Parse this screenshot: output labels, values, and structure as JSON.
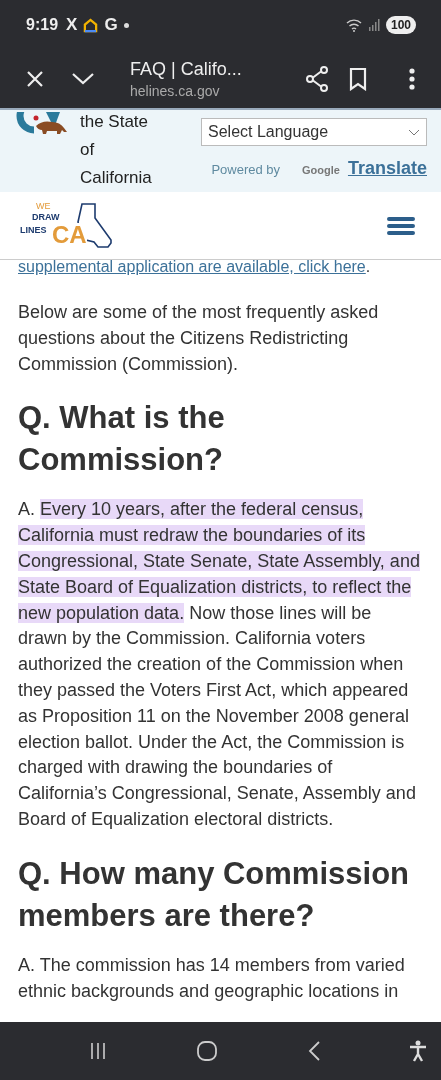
{
  "status_bar": {
    "time": "9:19",
    "notification_glyphs": [
      "X",
      "G"
    ],
    "battery": "100"
  },
  "browser_bar": {
    "title": "FAQ | Califo...",
    "url": "helines.ca.gov"
  },
  "gov_bar": {
    "agency": "the State of California",
    "language_select": {
      "value": "Select Language"
    },
    "powered_by": "Powered by",
    "google": "Google",
    "translate_link": "Translate"
  },
  "site_header": {
    "logo": {
      "we": "WE",
      "draw": "DRAW",
      "lines": "LINES",
      "ca": "CA"
    }
  },
  "content": [
    {
      "kind": "link_line",
      "text": "supplemental application are available, click here",
      "after": "."
    },
    {
      "kind": "paragraph",
      "segments": [
        {
          "text": "Below are some of the most frequently asked questions about the Citizens Redistricting Commission (Commission).",
          "highlighted": false
        }
      ]
    },
    {
      "kind": "heading",
      "text": "Q. What is the Commission?"
    },
    {
      "kind": "paragraph",
      "segments": [
        {
          "text": "A. ",
          "highlighted": false
        },
        {
          "text": "Every 10 years, after the federal census, California must redraw the boundaries of its Congressional, State Senate, State Assembly, and State Board of Equalization districts, to reflect the new population data.",
          "highlighted": true
        },
        {
          "text": " Now those lines will be drawn by the Commission. California voters authorized the creation of the Commission when they passed the Voters First Act, which appeared as Proposition 11 on the November 2008 general election ballot. Under the Act, the Commission is charged with drawing the boundaries of California’s Congressional, Senate, Assembly and Board of Equalization electoral districts.",
          "highlighted": false
        }
      ]
    },
    {
      "kind": "heading",
      "text": "Q. How many Commission members are there?"
    },
    {
      "kind": "paragraph",
      "segments": [
        {
          "text": "A. The commission has 14 members from varied ethnic backgrounds and geographic locations in",
          "highlighted": false
        }
      ]
    }
  ]
}
